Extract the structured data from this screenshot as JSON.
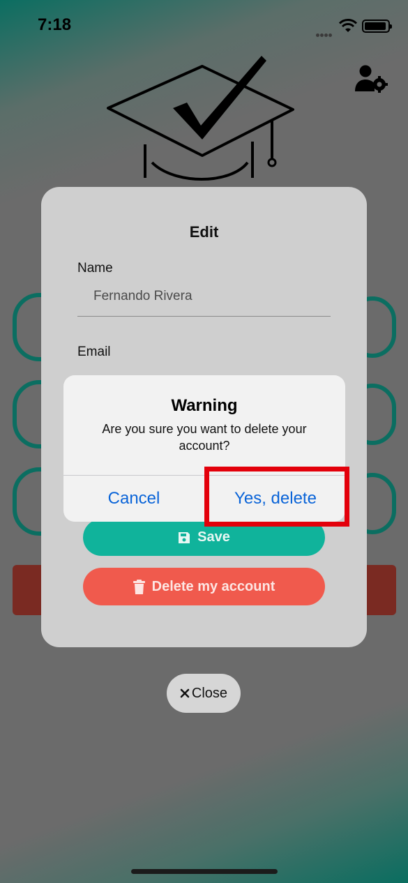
{
  "status_bar": {
    "time": "7:18"
  },
  "header_icons": {
    "profile_settings": "user-gear-icon",
    "logo": "graduation-cap-check-icon"
  },
  "edit_modal": {
    "title": "Edit",
    "name_label": "Name",
    "name_value": "Fernando Rivera",
    "email_label": "Email",
    "save_label": "Save",
    "delete_label": "Delete my account",
    "colors": {
      "save": "#10b39b",
      "delete": "#f05a4d"
    }
  },
  "alert": {
    "title": "Warning",
    "message": "Are you sure you want to delete your account?",
    "cancel_label": "Cancel",
    "confirm_label": "Yes, delete",
    "button_color": "#0a64d8"
  },
  "close_label": "Close"
}
